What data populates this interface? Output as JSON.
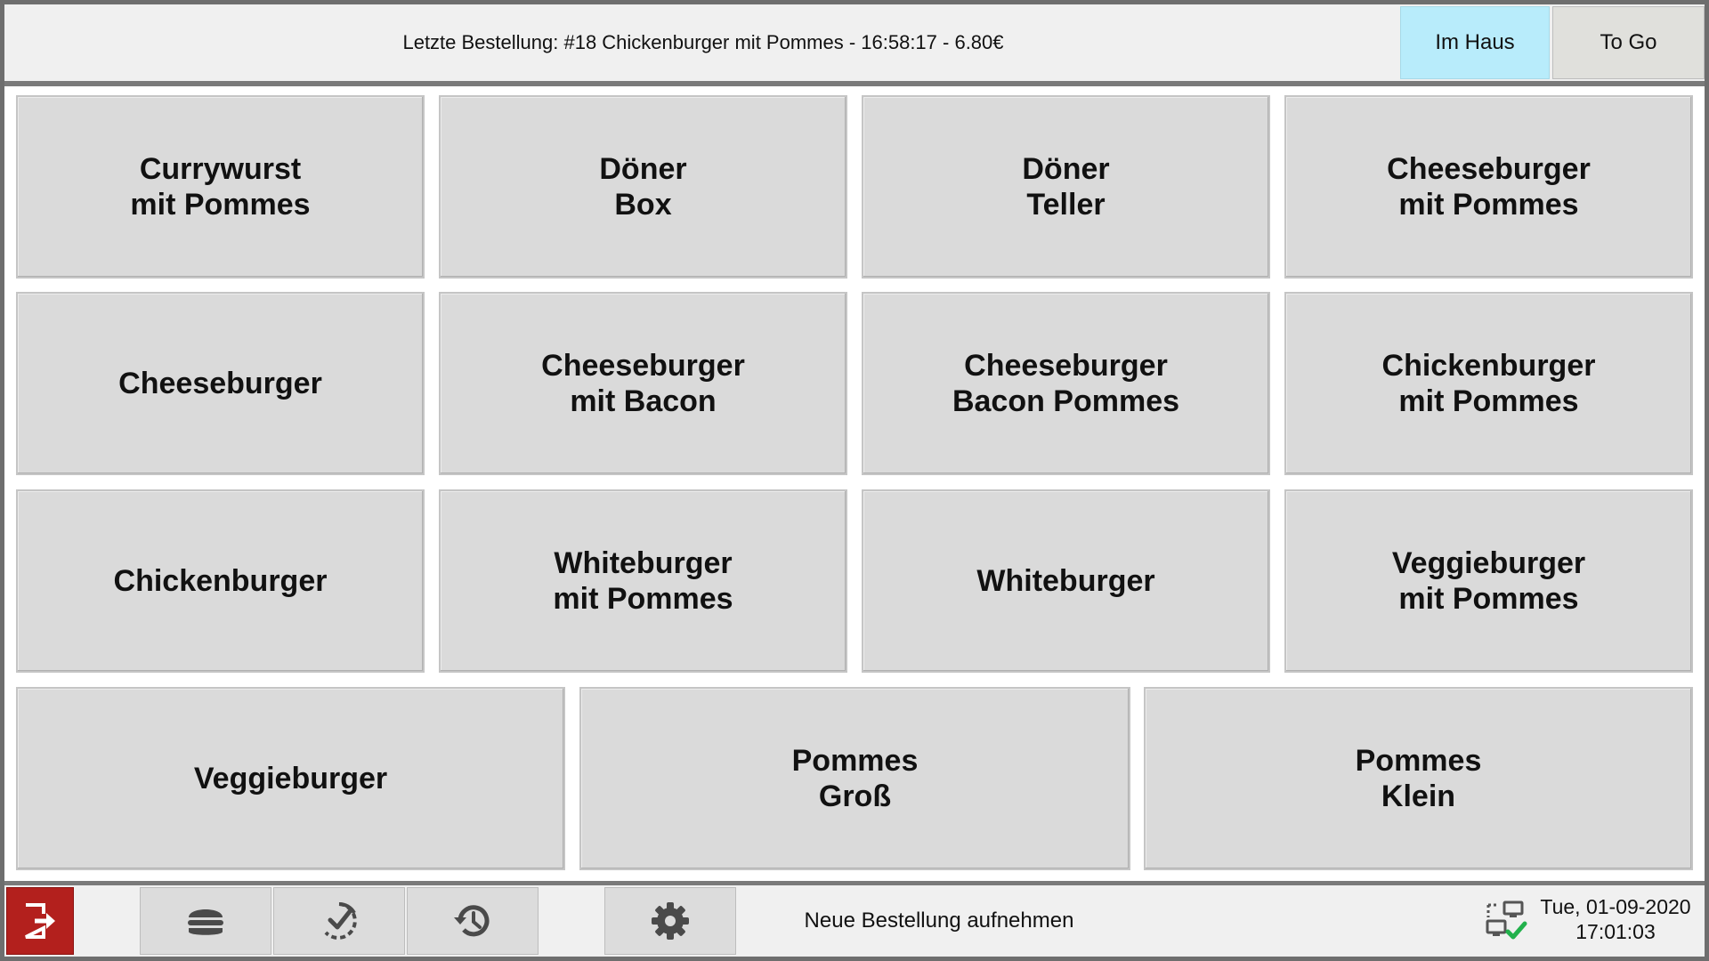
{
  "header": {
    "last_order": "Letzte Bestellung: #18 Chickenburger mit Pommes - 16:58:17 - 6.80€",
    "mode_buttons": [
      {
        "label": "Im Haus",
        "active": true,
        "color": "#b8ecfb"
      },
      {
        "label": "To Go",
        "active": false,
        "color": "#e0e0dc"
      }
    ]
  },
  "menu_items": [
    "Currywurst\nmit Pommes",
    "Döner\nBox",
    "Döner\nTeller",
    "Cheeseburger\nmit Pommes",
    "Cheeseburger",
    "Cheeseburger\nmit Bacon",
    "Cheeseburger\nBacon Pommes",
    "Chickenburger\nmit Pommes",
    "Chickenburger",
    "Whiteburger\nmit Pommes",
    "Whiteburger",
    "Veggieburger\nmit Pommes",
    "Veggieburger",
    "Pommes\nGroß",
    "Pommes\nKlein"
  ],
  "footer": {
    "icons": [
      "logout-icon",
      "burger-icon",
      "check-progress-icon",
      "history-icon",
      "gear-icon",
      "network-status-icon"
    ],
    "status_text": "Neue Bestellung aufnehmen",
    "date": "Tue, 01-09-2020",
    "time": "17:01:03"
  },
  "colors": {
    "logout": "#b3201d",
    "active_mode": "#b8ecfb",
    "button": "#dadada",
    "icon": "#4a4a4a",
    "network_ok": "#22b14c"
  }
}
